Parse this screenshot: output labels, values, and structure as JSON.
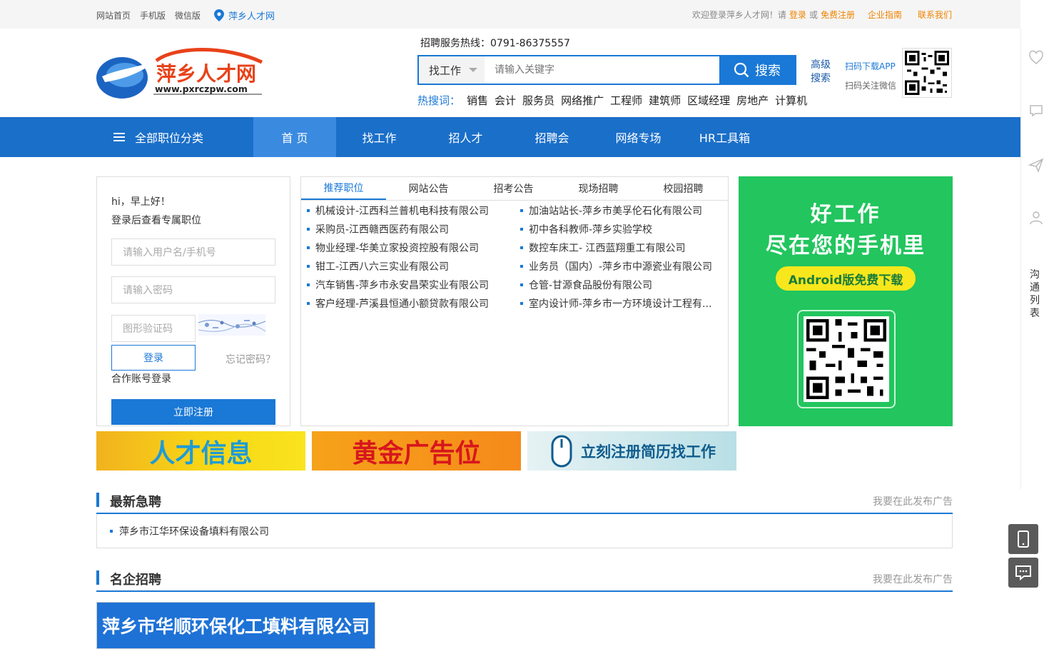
{
  "topbar": {
    "links": [
      "网站首页",
      "手机版",
      "微信版"
    ],
    "location": "萍乡人才网",
    "welcome": "欢迎登录萍乡人才网！请",
    "login": "登录",
    "or": "或",
    "register": "免费注册",
    "guide": "企业指南",
    "contact": "联系我们"
  },
  "header": {
    "logo_text": "萍乡人才网",
    "logo_url": "www.pxrczpw.com",
    "hotline": "招聘服务热线：0791-86375557",
    "search_type": "找工作",
    "search_placeholder": "请输入关键字",
    "search_button": "搜索",
    "advanced": "高级搜索",
    "app_download": "扫码下载APP",
    "follow_wechat": "扫码关注微信",
    "hot_label": "热搜词：",
    "hot_words": [
      "销售",
      "会计",
      "服务员",
      "网络推广",
      "工程师",
      "建筑师",
      "区域经理",
      "房地产",
      "计算机"
    ]
  },
  "nav": {
    "all": "全部职位分类",
    "items": [
      "首 页",
      "找工作",
      "招人才",
      "招聘会",
      "网络专场",
      "HR工具箱"
    ]
  },
  "login": {
    "hi": "hi，早上好！",
    "sub": "登录后查看专属职位",
    "user_placeholder": "请输入用户名/手机号",
    "pass_placeholder": "请输入密码",
    "captcha_placeholder": "图形验证码",
    "login_button": "登录",
    "forgot": "忘记密码？",
    "coop": "合作账号登录",
    "register_button": "立即注册"
  },
  "tabs": [
    "推荐职位",
    "网站公告",
    "招考公告",
    "现场招聘",
    "校园招聘"
  ],
  "jobs": [
    "机械设计-江西科兰普机电科技有限公司",
    "加油站站长-萍乡市美孚伦石化有限公司",
    "采购员-江西赣西医药有限公司",
    "初中各科教师-萍乡实验学校",
    "物业经理-华美立家投资控股有限公司",
    "数控车床工- 江西蓝翔重工有限公司",
    "钳工-江西八六三实业有限公司",
    "业务员（国内）-萍乡市中源瓷业有限公司",
    "汽车销售-萍乡市永安昌荣实业有限公司",
    "仓管-甘源食品股份有限公司",
    "客户经理-芦溪县恒通小额贷款有限公司",
    "室内设计师-萍乡市一方环境设计工程有..."
  ],
  "side_ad": {
    "line1": "好工作",
    "line2": "尽在您的手机里",
    "pill": "Android版免费下载"
  },
  "banners": [
    "人才信息",
    "黄金广告位",
    "立刻注册简历找工作"
  ],
  "urgent": {
    "title": "最新急聘",
    "ad": "我要在此发布广告",
    "items": [
      "萍乡市江华环保设备填料有限公司"
    ]
  },
  "famous": {
    "title": "名企招聘",
    "ad": "我要在此发布广告",
    "corp": "萍乡市华顺环保化工填料有限公司"
  },
  "rail": {
    "text": "沟通列表"
  }
}
